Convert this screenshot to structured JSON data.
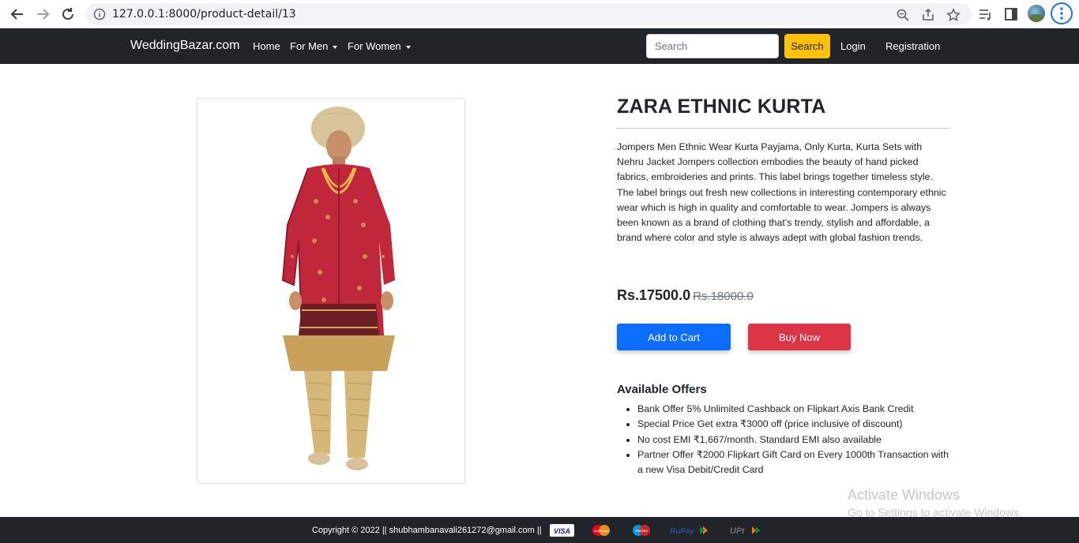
{
  "browser": {
    "url": "127.0.0.1:8000/product-detail/13",
    "icons": [
      "back-arrow-icon",
      "forward-arrow-icon",
      "reload-icon",
      "info-icon",
      "zoom-icon",
      "share-icon",
      "bookmark-star-icon",
      "reading-list-icon",
      "side-panel-icon",
      "avatar",
      "more-menu-icon"
    ]
  },
  "navbar": {
    "brand": "WeddingBazar.com",
    "links": {
      "home": "Home",
      "men": "For Men",
      "women": "For Women",
      "login": "Login",
      "registration": "Registration"
    },
    "search": {
      "placeholder": "Search",
      "button": "Search"
    }
  },
  "product": {
    "title": "ZARA ETHNIC KURTA",
    "description": "Jompers Men Ethnic Wear Kurta Payjama, Only Kurta, Kurta Sets with Nehru Jacket Jompers collection embodies the beauty of hand picked fabrics, embroideries and prints. This label brings together timeless style. The label brings out fresh new collections in interesting contemporary ethnic wear which is high in quality and comfortable to wear. Jompers is always been known as a brand of clothing that's trendy, stylish and affordable, a brand where color and style is always adept with global fashion trends.",
    "price": "Rs.17500.0",
    "old_price": "Rs.18000.0",
    "add_to_cart": "Add to Cart",
    "buy_now": "Buy Now",
    "offers_heading": "Available Offers",
    "offers": [
      "Bank Offer 5% Unlimited Cashback on Flipkart Axis Bank Credit",
      "Special Price Get extra ₹3000 off (price inclusive of discount)",
      "No cost EMI ₹1,667/month. Standard EMI also available",
      "Partner Offer ₹2000 Flipkart Gift Card on Every 1000th Transaction with a new Visa Debit/Credit Card"
    ]
  },
  "watermark": {
    "line1": "Activate Windows",
    "line2": "Go to Settings to activate Windows."
  },
  "footer": {
    "copyright": "Copyright © 2022 || shubhambanavali261272@gmail.com ||",
    "payment_logos": {
      "visa": "VISA",
      "mastercard": "MasterCard",
      "maestro": "Maestro",
      "rupay": "RuPay",
      "upi": "UPI"
    }
  },
  "colors": {
    "navbar_bg": "#212529",
    "search_button": "#ffc107",
    "add_to_cart": "#0d6efd",
    "buy_now": "#dc3545"
  }
}
